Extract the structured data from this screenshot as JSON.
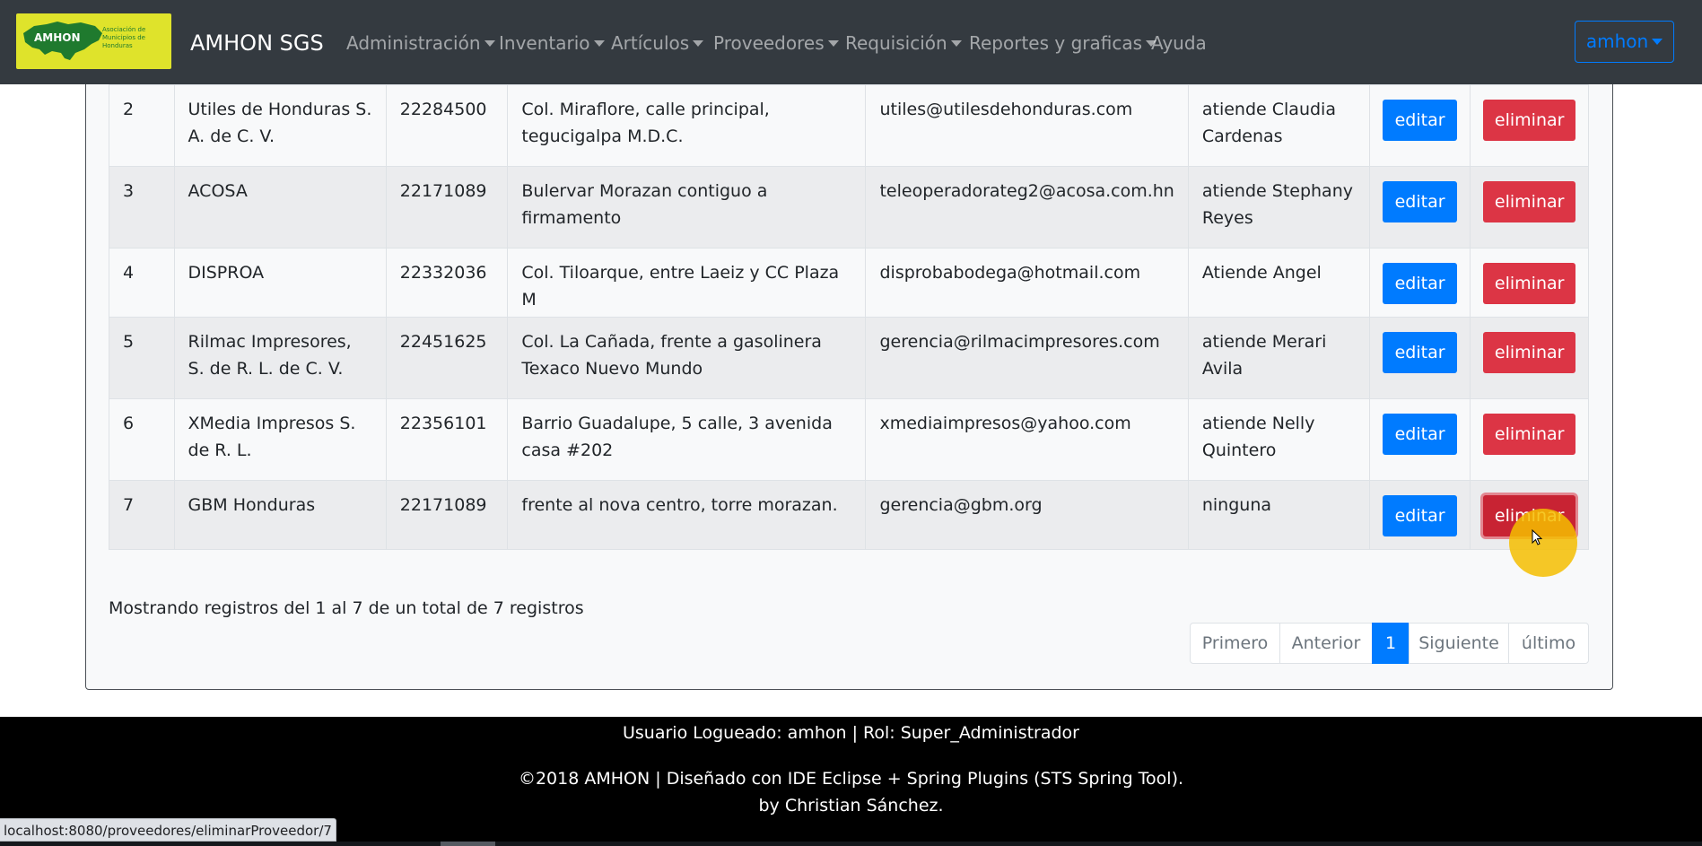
{
  "brand": {
    "logo_text": "AMHON",
    "logo_caption": "Asociación de Municipios de Honduras",
    "name": "AMHON SGS"
  },
  "nav": {
    "items": [
      {
        "label": "Administración",
        "dropdown": true
      },
      {
        "label": "Inventario",
        "dropdown": true
      },
      {
        "label": "Artículos",
        "dropdown": true
      },
      {
        "label": "Proveedores",
        "dropdown": true
      },
      {
        "label": "Requisición",
        "dropdown": true
      },
      {
        "label": "Reportes y graficas",
        "dropdown": true
      },
      {
        "label": "Ayuda",
        "dropdown": false
      }
    ],
    "user": "amhon"
  },
  "table": {
    "edit_label": "editar",
    "delete_label": "eliminar",
    "rows": [
      {
        "id": "2",
        "name": "Utiles de Honduras S. A. de C. V.",
        "phone": "22284500",
        "address": "Col. Miraflore, calle principal, tegucigalpa M.D.C.",
        "email": "utiles@utilesdehonduras.com",
        "contact": "atiende Claudia Cardenas"
      },
      {
        "id": "3",
        "name": "ACOSA",
        "phone": "22171089",
        "address": "Bulervar Morazan contiguo a firmamento",
        "email": "teleoperadorateg2@acosa.com.hn",
        "contact": "atiende Stephany Reyes"
      },
      {
        "id": "4",
        "name": "DISPROA",
        "phone": "22332036",
        "address": "Col. Tiloarque, entre Laeiz y CC Plaza M",
        "email": "disprobabodega@hotmail.com",
        "contact": "Atiende Angel"
      },
      {
        "id": "5",
        "name": "Rilmac Impresores, S. de R. L. de C. V.",
        "phone": "22451625",
        "address": "Col. La Cañada, frente a gasolinera Texaco Nuevo Mundo",
        "email": "gerencia@rilmacimpresores.com",
        "contact": "atiende Merari Avila"
      },
      {
        "id": "6",
        "name": "XMedia Impresos S. de R. L.",
        "phone": "22356101",
        "address": "Barrio Guadalupe, 5 calle, 3 avenida casa #202",
        "email": "xmediaimpresos@yahoo.com",
        "contact": "atiende Nelly Quintero"
      },
      {
        "id": "7",
        "name": "GBM Honduras",
        "phone": "22171089",
        "address": "frente al nova centro, torre morazan.",
        "email": "gerencia@gbm.org",
        "contact": "ninguna"
      }
    ]
  },
  "info": "Mostrando registros del 1 al 7 de un total de 7 registros",
  "pagination": {
    "first": "Primero",
    "prev": "Anterior",
    "current": "1",
    "next": "Siguiente",
    "last": "último"
  },
  "footer": {
    "line1": "Usuario Logueado: amhon | Rol: Super_Administrador",
    "line2": "©2018 AMHON | Diseñado con IDE Eclipse + Spring Plugins (STS Spring Tool).",
    "line3": "by Christian Sánchez."
  },
  "status_url": "localhost:8080/proveedores/eliminarProveedor/7",
  "colors": {
    "navbar": "#343a40",
    "primary": "#007bff",
    "danger": "#dc3545",
    "logo_bg": "#dfe32b",
    "footer": "#000000"
  }
}
